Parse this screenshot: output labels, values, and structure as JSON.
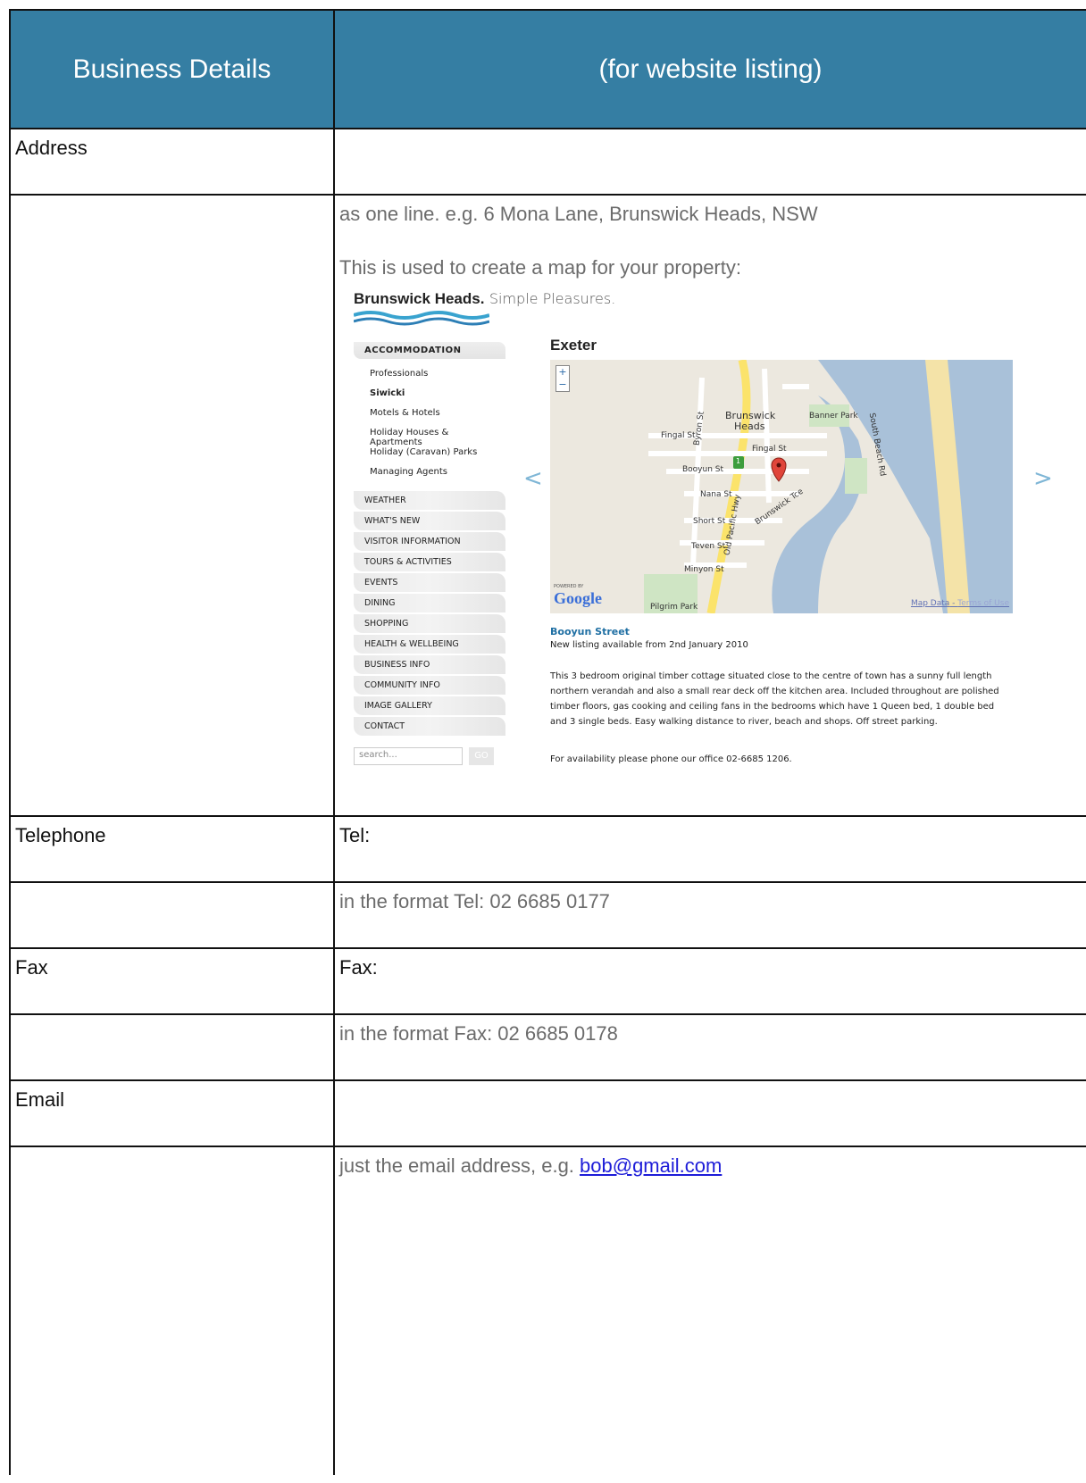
{
  "header": {
    "left": "Business Details",
    "right": "(for website listing)"
  },
  "address": {
    "label": "Address",
    "hint_line1": "as one line. e.g. 6 Mona Lane, Brunswick Heads, NSW",
    "hint_line2": "This is used to create a map for your property:"
  },
  "site_preview": {
    "brand_bold": "Brunswick Heads.",
    "brand_light": "Simple Pleasures.",
    "nav_heading": "ACCOMMODATION",
    "sub_items": [
      "Professionals",
      "Siwicki",
      "Motels & Hotels",
      "Holiday Houses & Apartments",
      "Holiday (Caravan) Parks",
      "Managing Agents"
    ],
    "nav_items": [
      "WEATHER",
      "WHAT'S NEW",
      "VISITOR INFORMATION",
      "TOURS & ACTIVITIES",
      "EVENTS",
      "DINING",
      "SHOPPING",
      "HEALTH & WELLBEING",
      "BUSINESS INFO",
      "COMMUNITY INFO",
      "IMAGE GALLERY",
      "CONTACT"
    ],
    "search_placeholder": "search...",
    "go": "GO",
    "prev": "<",
    "next": ">",
    "place_title": "Exeter",
    "map_labels": {
      "town1": "Brunswick",
      "town2": "Heads",
      "banner_park": "Banner Park",
      "fingal_st_1": "Fingal St",
      "fingal_st_2": "Fingal St",
      "booyun_st": "Booyun St",
      "nana_st": "Nana St",
      "short_st": "Short St",
      "teven_st": "Teven St",
      "minyon_st": "Minyon St",
      "pilgrim_park": "Pilgrim Park",
      "old_pacific_hwy": "Old Pacific Hwy",
      "byron_st": "Byron St",
      "brunswick_tce": "Brunswick Tce",
      "south_beach_rd": "South Beach Rd",
      "route": "1"
    },
    "powered_by": "POWERED BY",
    "google": "Google",
    "map_data": "Map Data",
    "terms": "Terms of Use",
    "listing_title": "Booyun Street",
    "listing_date": "New listing available from 2nd January 2010",
    "listing_body": "This 3 bedroom original timber cottage situated close to the centre of town has a sunny full length northern verandah and also a small rear deck off the kitchen area. Included throughout are polished timber floors, gas cooking and ceiling fans in the bedrooms which have 1 Queen bed, 1 double bed and 3 single beds. Easy walking distance to river, beach and shops. Off street parking.",
    "listing_availability": "For availability please phone our office 02-6685 1206."
  },
  "telephone": {
    "label": "Telephone",
    "value": "Tel:",
    "hint": "in the format Tel: 02 6685 0177"
  },
  "fax": {
    "label": "Fax",
    "value": "Fax:",
    "hint": "in the format Fax: 02 6685 0178"
  },
  "email": {
    "label": "Email",
    "hint_prefix": "just the email address, e.g. ",
    "example": "bob@gmail.com"
  },
  "colors": {
    "header_bg": "#357ea3",
    "hint_text": "#6b6b6b",
    "link": "#1d1cd8"
  }
}
